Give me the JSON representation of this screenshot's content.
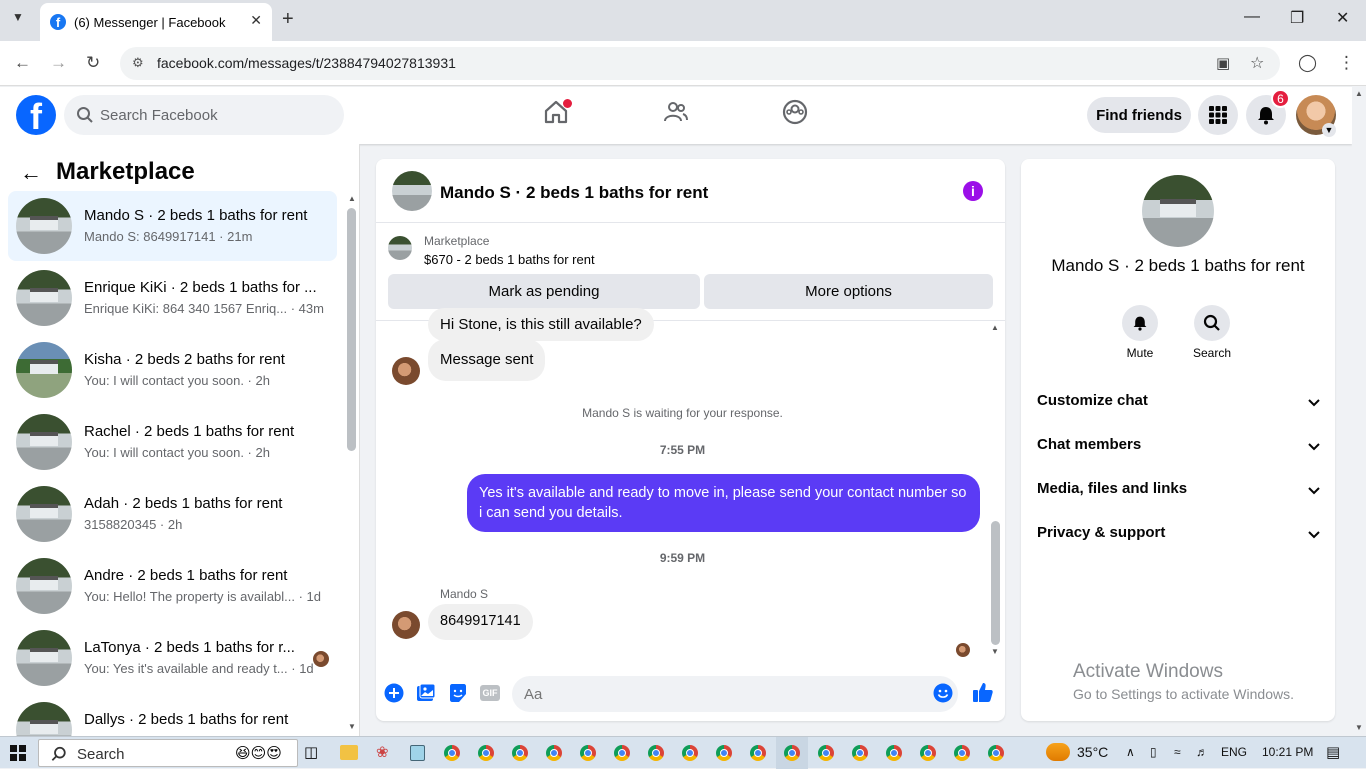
{
  "browser": {
    "tab_title": "(6) Messenger | Facebook",
    "url": "facebook.com/messages/t/23884794027813931"
  },
  "fb": {
    "search_placeholder": "Search Facebook",
    "find_friends": "Find friends",
    "notif_count": "6"
  },
  "sidebar": {
    "title": "Marketplace",
    "conversations": [
      {
        "name": "Mando S · 2 beds 1 baths for rent",
        "preview": "Mando S: 8649917141 · 21m"
      },
      {
        "name": "Enrique KiKi · 2 beds 1 baths for ...",
        "preview": "Enrique KiKi: 864 340 1567 Enriq... · 43m"
      },
      {
        "name": "Kisha · 2 beds 2 baths for rent",
        "preview": "You: I will contact you soon. · 2h"
      },
      {
        "name": "Rachel · 2 beds 1 baths for rent",
        "preview": "You: I will contact you soon. · 2h"
      },
      {
        "name": "Adah · 2 beds 1 baths for rent",
        "preview": "3158820345 · 2h"
      },
      {
        "name": "Andre · 2 beds 1 baths for rent",
        "preview": "You: Hello! The property is availabl... · 1d"
      },
      {
        "name": "LaTonya · 2 beds 1 baths for r...",
        "preview": "You: Yes it's available and ready t... · 1d"
      },
      {
        "name": "Dallys · 2 beds 1 baths for rent",
        "preview": ""
      }
    ]
  },
  "chat": {
    "title": "Mando S · 2 beds 1 baths for rent",
    "marketplace_label": "Marketplace",
    "listing": "$670 - 2 beds 1 baths for rent",
    "mark_pending": "Mark as pending",
    "more_options": "More options",
    "cut_message": "Hi Stone, is this still available?",
    "message_sent": "Message sent",
    "waiting": "Mando S is waiting for your response.",
    "time1": "7:55 PM",
    "out_message": "Yes it's available and ready to move in, please send your contact number so i can send you details.",
    "time2": "9:59 PM",
    "sender": "Mando S",
    "last_message": "8649917141",
    "composer_placeholder": "Aa",
    "gif_label": "GIF"
  },
  "rpanel": {
    "name": "Mando S · 2 beds 1 baths for rent",
    "mute": "Mute",
    "search": "Search",
    "sections": [
      "Customize chat",
      "Chat members",
      "Media, files and links",
      "Privacy & support"
    ],
    "watermark_title": "Activate Windows",
    "watermark_sub": "Go to Settings to activate Windows."
  },
  "taskbar": {
    "search": "Search",
    "temp": "35°C",
    "lang": "ENG",
    "time": "10:21 PM"
  },
  "colors": {
    "fb_blue": "#0866ff",
    "outgoing_bubble": "#5b3bf5",
    "info_purple": "#9b0fe8"
  }
}
